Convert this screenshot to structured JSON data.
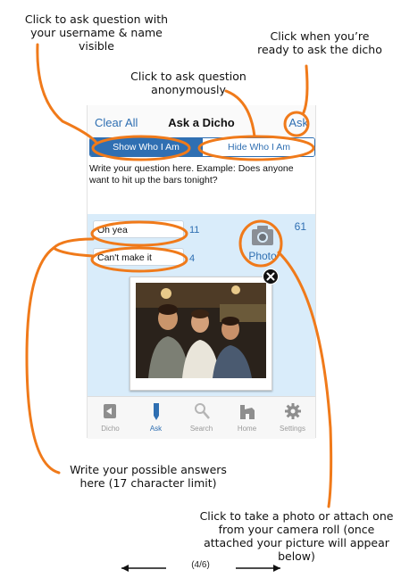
{
  "annotations": {
    "username": "Click to ask question with your username & name visible",
    "ready": "Click when you’re ready to ask the dicho",
    "anonymous": "Click to ask question anonymously",
    "answers": "Write your possible answers here (17 character limit)",
    "photo": "Click to take a photo or attach one from your camera roll (once attached your picture will appear below)"
  },
  "nav": {
    "clear": "Clear All",
    "title": "Ask a Dicho",
    "ask": "Ask"
  },
  "segment": {
    "show": "Show Who I Am",
    "hide": "Hide Who I Am",
    "selected": "Show Who I Am"
  },
  "prompt": "Write your question here. Example: Does anyone want to hit up the bars tonight?",
  "char_count": "61",
  "answers": [
    {
      "text": "Oh yea",
      "count": "11"
    },
    {
      "text": "Can't make it",
      "count": "4"
    }
  ],
  "photo_label": "Photo",
  "tabs": [
    {
      "label": "Dicho",
      "icon": "dicho-icon"
    },
    {
      "label": "Ask",
      "icon": "pencil-icon",
      "active": true
    },
    {
      "label": "Search",
      "icon": "magnifier-icon"
    },
    {
      "label": "Home",
      "icon": "home-icon"
    },
    {
      "label": "Settings",
      "icon": "gear-icon"
    }
  ],
  "pager": "(4/6)",
  "colors": {
    "callout": "#f07a1a",
    "ios_blue": "#2f6fb2",
    "content_bg": "#d9ecfa"
  }
}
